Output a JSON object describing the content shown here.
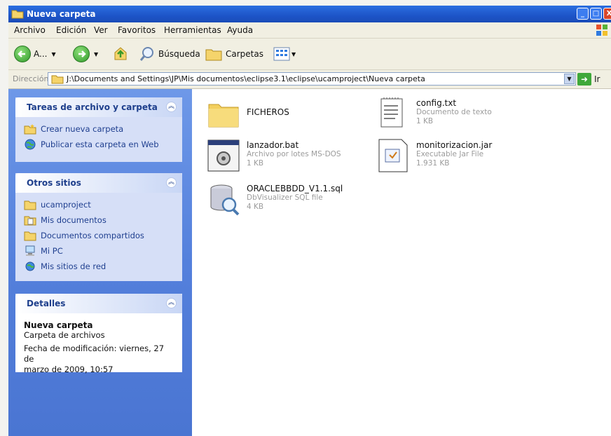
{
  "window": {
    "title": "Nueva carpeta",
    "title_buttons": [
      "_",
      "□",
      "X"
    ]
  },
  "menubar": {
    "items": [
      "Archivo",
      "Edición",
      "Ver",
      "Favoritos",
      "Herramientas",
      "Ayuda"
    ]
  },
  "toolbar": {
    "back_label": "A...",
    "search_label": "Búsqueda",
    "folders_label": "Carpetas"
  },
  "addressbar": {
    "label": "Dirección",
    "path": "J:\\Documents and Settings\\JP\\Mis documentos\\eclipse3.1\\eclipse\\ucamproject\\Nueva carpeta",
    "go_label": "Ir"
  },
  "taskpane": {
    "tasks": {
      "title": "Tareas de archivo y carpeta",
      "items": [
        "Crear nueva carpeta",
        "Publicar esta carpeta en Web"
      ]
    },
    "other_places": {
      "title": "Otros sitios",
      "items": [
        "ucamproject",
        "Mis documentos",
        "Documentos compartidos",
        "Mi PC",
        "Mis sitios de red"
      ]
    },
    "details": {
      "title": "Detalles",
      "name": "Nueva carpeta",
      "type": "Carpeta de archivos",
      "modified_line1": "Fecha de modificación: viernes, 27 de",
      "modified_line2": "marzo de 2009, 10:57"
    }
  },
  "files": [
    {
      "name": "FICHEROS",
      "type": "",
      "size": "",
      "icon": "folder-icon"
    },
    {
      "name": "config.txt",
      "type": "Documento de texto",
      "size": "1 KB",
      "icon": "text-file-icon"
    },
    {
      "name": "lanzador.bat",
      "type": "Archivo por lotes MS-DOS",
      "size": "1 KB",
      "icon": "batch-file-icon"
    },
    {
      "name": "monitorizacion.jar",
      "type": "Executable Jar File",
      "size": "1.931 KB",
      "icon": "jar-file-icon"
    },
    {
      "name": "ORACLEBBDD_V1.1.sql",
      "type": "DbVisualizer SQL file",
      "size": "4 KB",
      "icon": "sql-file-icon"
    }
  ],
  "colors": {
    "title_bar": "#1d54c8",
    "task_pane": "#5480dc",
    "panel_bg": "#d6dff7",
    "panel_title": "#1e3f8c",
    "link": "#1f3f8f"
  }
}
